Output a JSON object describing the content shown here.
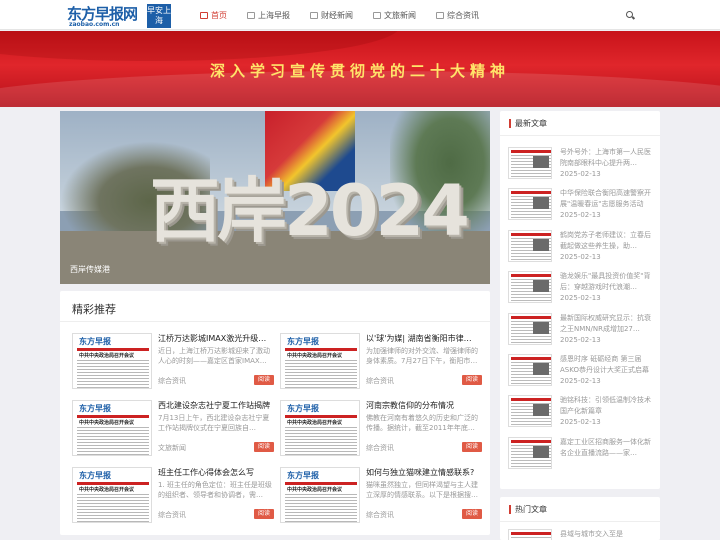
{
  "header": {
    "logo_text": "东方早报网",
    "logo_url": "zaobao.com.cn",
    "logo_box": "早安上海",
    "nav": [
      {
        "label": "首页",
        "active": true
      },
      {
        "label": "上海早报",
        "active": false
      },
      {
        "label": "财经新闻",
        "active": false
      },
      {
        "label": "文旅新闻",
        "active": false
      },
      {
        "label": "综合资讯",
        "active": false
      }
    ]
  },
  "banner": {
    "text": "深入学习宣传贯彻党的二十大精神"
  },
  "carousel": {
    "sign_text": "西岸2024",
    "caption": "西岸传媒港"
  },
  "featured": {
    "title": "精彩推荐",
    "read_label": "阅读",
    "thumb_masthead": "东方早报",
    "thumb_headline": "中共中央政治局召开会议",
    "items": [
      {
        "title": "江桥万达影城IMAX激光升级…",
        "summary": "近日，上海江桥万达影城迎来了激动人心的时刻——嘉定区首家IMAX…",
        "category": "综合资讯"
      },
      {
        "title": "以'球'为媒| 湖南省衡阳市律…",
        "summary": "为加强律师的对外交流、增强律师的身体素质。7月27日下午，衡阳市…",
        "category": "综合资讯"
      },
      {
        "title": "西北建设杂志社宁夏工作站揭牌",
        "summary": "7月13日上午，西北建设杂志社宁夏工作站揭牌仪式在宁夏回族自…",
        "category": "文旅新闻"
      },
      {
        "title": "河南宗教信仰的分布情况",
        "summary": "佛教在河南有着悠久的历史和广泛的传播。据统计，截至2011年年底…",
        "category": "综合资讯"
      },
      {
        "title": "班主任工作心得体会怎么写",
        "summary": "1. 班主任的角色定位：班主任是班级的组织者、领导者和协调者，需…",
        "category": "综合资讯"
      },
      {
        "title": "如何与独立猫咪建立情感联系?",
        "summary": "猫咪虽然独立，但同样渴望与主人建立深厚的情感联系。以下是根据搜…",
        "category": "综合资讯"
      }
    ]
  },
  "sidebar": {
    "latest_title": "最新文章",
    "latest": [
      {
        "text": "号外号外：上海市第一人民医院南部眼科中心提升两…",
        "date": "2025-02-13"
      },
      {
        "text": "中华保险联合衡阳高速警察开展\"温暖春运\"志愿服务活动",
        "date": "2025-02-13"
      },
      {
        "text": "鹤岗党苏子老师建议：立春后截起做这些养生操，助…",
        "date": "2025-02-13"
      },
      {
        "text": "骆龙娱乐\"最具投资价值奖\"背后：穿越游戏时代浪潮…",
        "date": "2025-02-13"
      },
      {
        "text": "最新国际权威研究显示：抗衰之王NMN/NR成增加27…",
        "date": "2025-02-13"
      },
      {
        "text": "感恩时序 砥砺经商 第三届ASKO恭丹设计大奖正式启幕",
        "date": "2025-02-13"
      },
      {
        "text": "驰铭科技：引领低温制冷技术国产化新篇章",
        "date": "2025-02-13"
      },
      {
        "text": "嘉定工业区招商服务一体化新名企业直播流路——家…",
        "date": ""
      }
    ],
    "hot_title": "热门文章",
    "hot": [
      {
        "text": "县域与城市交入至是",
        "date": ""
      }
    ]
  }
}
